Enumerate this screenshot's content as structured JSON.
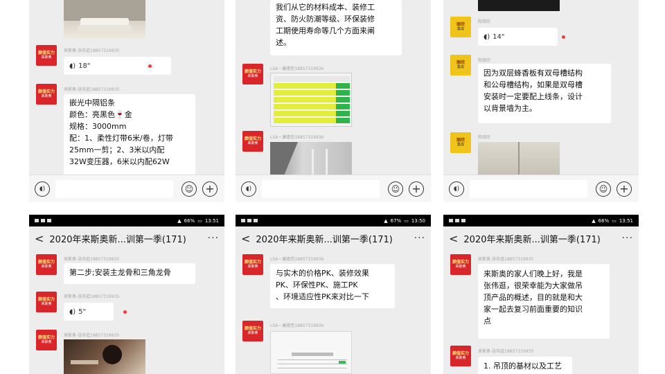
{
  "p1": {
    "voice1": {
      "sender": "来斯奥-张伟逛18857319935",
      "duration": "18\""
    },
    "msg2": {
      "sender": "来斯奥-张伟逛18857319935",
      "lines": [
        "嵌光中隔铝条",
        "颜色：亮黑色🍷金",
        "规格：3000mm",
        "配：1、柔性灯带6米/卷，灯带",
        "25mm一剪；2、3米以内配",
        "32W变压器，6米以内配62W"
      ]
    }
  },
  "p2": {
    "msg1": {
      "lines": [
        "我们从它的材料成本、装修工",
        "资、防火防潮等级、环保装修",
        "工期使用寿命等几个方面来阐",
        "述。"
      ]
    },
    "sender2": "LSA－康惠哲18857319936",
    "sender3": "LSA－康惠哲18857319936"
  },
  "p3": {
    "voice1": {
      "sender": "陈丽欣",
      "duration": "14\""
    },
    "msg2": {
      "sender": "陈丽欣",
      "lines": [
        "因为双层蜂香板有双母槽结构",
        "和公母槽结构，如果是双母槽",
        "安装时一定要配上线条，设计",
        "以背景墙为主。"
      ]
    },
    "sender3": "陈丽欣"
  },
  "p4": {
    "status": {
      "battery": "66%",
      "time": "13:51"
    },
    "title": "2020年来斯奥新...训第一季(171)",
    "msg1": {
      "sender": "来斯奥-张伟逛18857319935",
      "text": "第二步;安装主龙骨和三角龙骨"
    },
    "voice2": {
      "sender": "来斯奥-张伟逛18857319935",
      "duration": "5\""
    },
    "sender3": "来斯奥-张伟逛18857319935"
  },
  "p5": {
    "status": {
      "battery": "67%",
      "time": "13:50"
    },
    "title": "2020年来斯奥新...训第一季(171)",
    "msg1": {
      "sender": "LSA－康惠哲18857319936",
      "lines": [
        "与实木的价格PK、装修效果",
        "PK、环保性PK、施工PK",
        "、环境适应性PK来对比一下"
      ]
    },
    "sender2": "LSA－康惠哲18857319936"
  },
  "p6": {
    "status": {
      "battery": "66%",
      "time": "13:51"
    },
    "title": "2020年来斯奥新...训第一季(171)",
    "msg1": {
      "sender": "来斯奥-张伟逛18857319935",
      "lines": [
        "来斯奥的家人们晚上好，我是",
        "张伟逛，很荣幸能为大家做吊",
        "顶产品的概述，目的就是和大",
        "家一起去复习前面重要的知识",
        "点"
      ]
    },
    "msg2": {
      "sender": "来斯奥-张伟逛18857319935",
      "text": "1. 吊顶的基材以及工艺"
    }
  },
  "avatar": {
    "red_line1": "颜值实力",
    "red_line2": "来斯奥",
    "yellow_line1": "丽欣",
    "yellow_line2": "集成"
  },
  "icons": {
    "voice": "voice-icon",
    "emoji": "emoji-icon",
    "plus": "plus-icon",
    "back": "back-chevron-icon",
    "more": "more-dots-icon"
  },
  "colors": {
    "brand_red": "#d8262b",
    "chat_bg": "#ededed",
    "unread_dot": "#f23a3a"
  }
}
